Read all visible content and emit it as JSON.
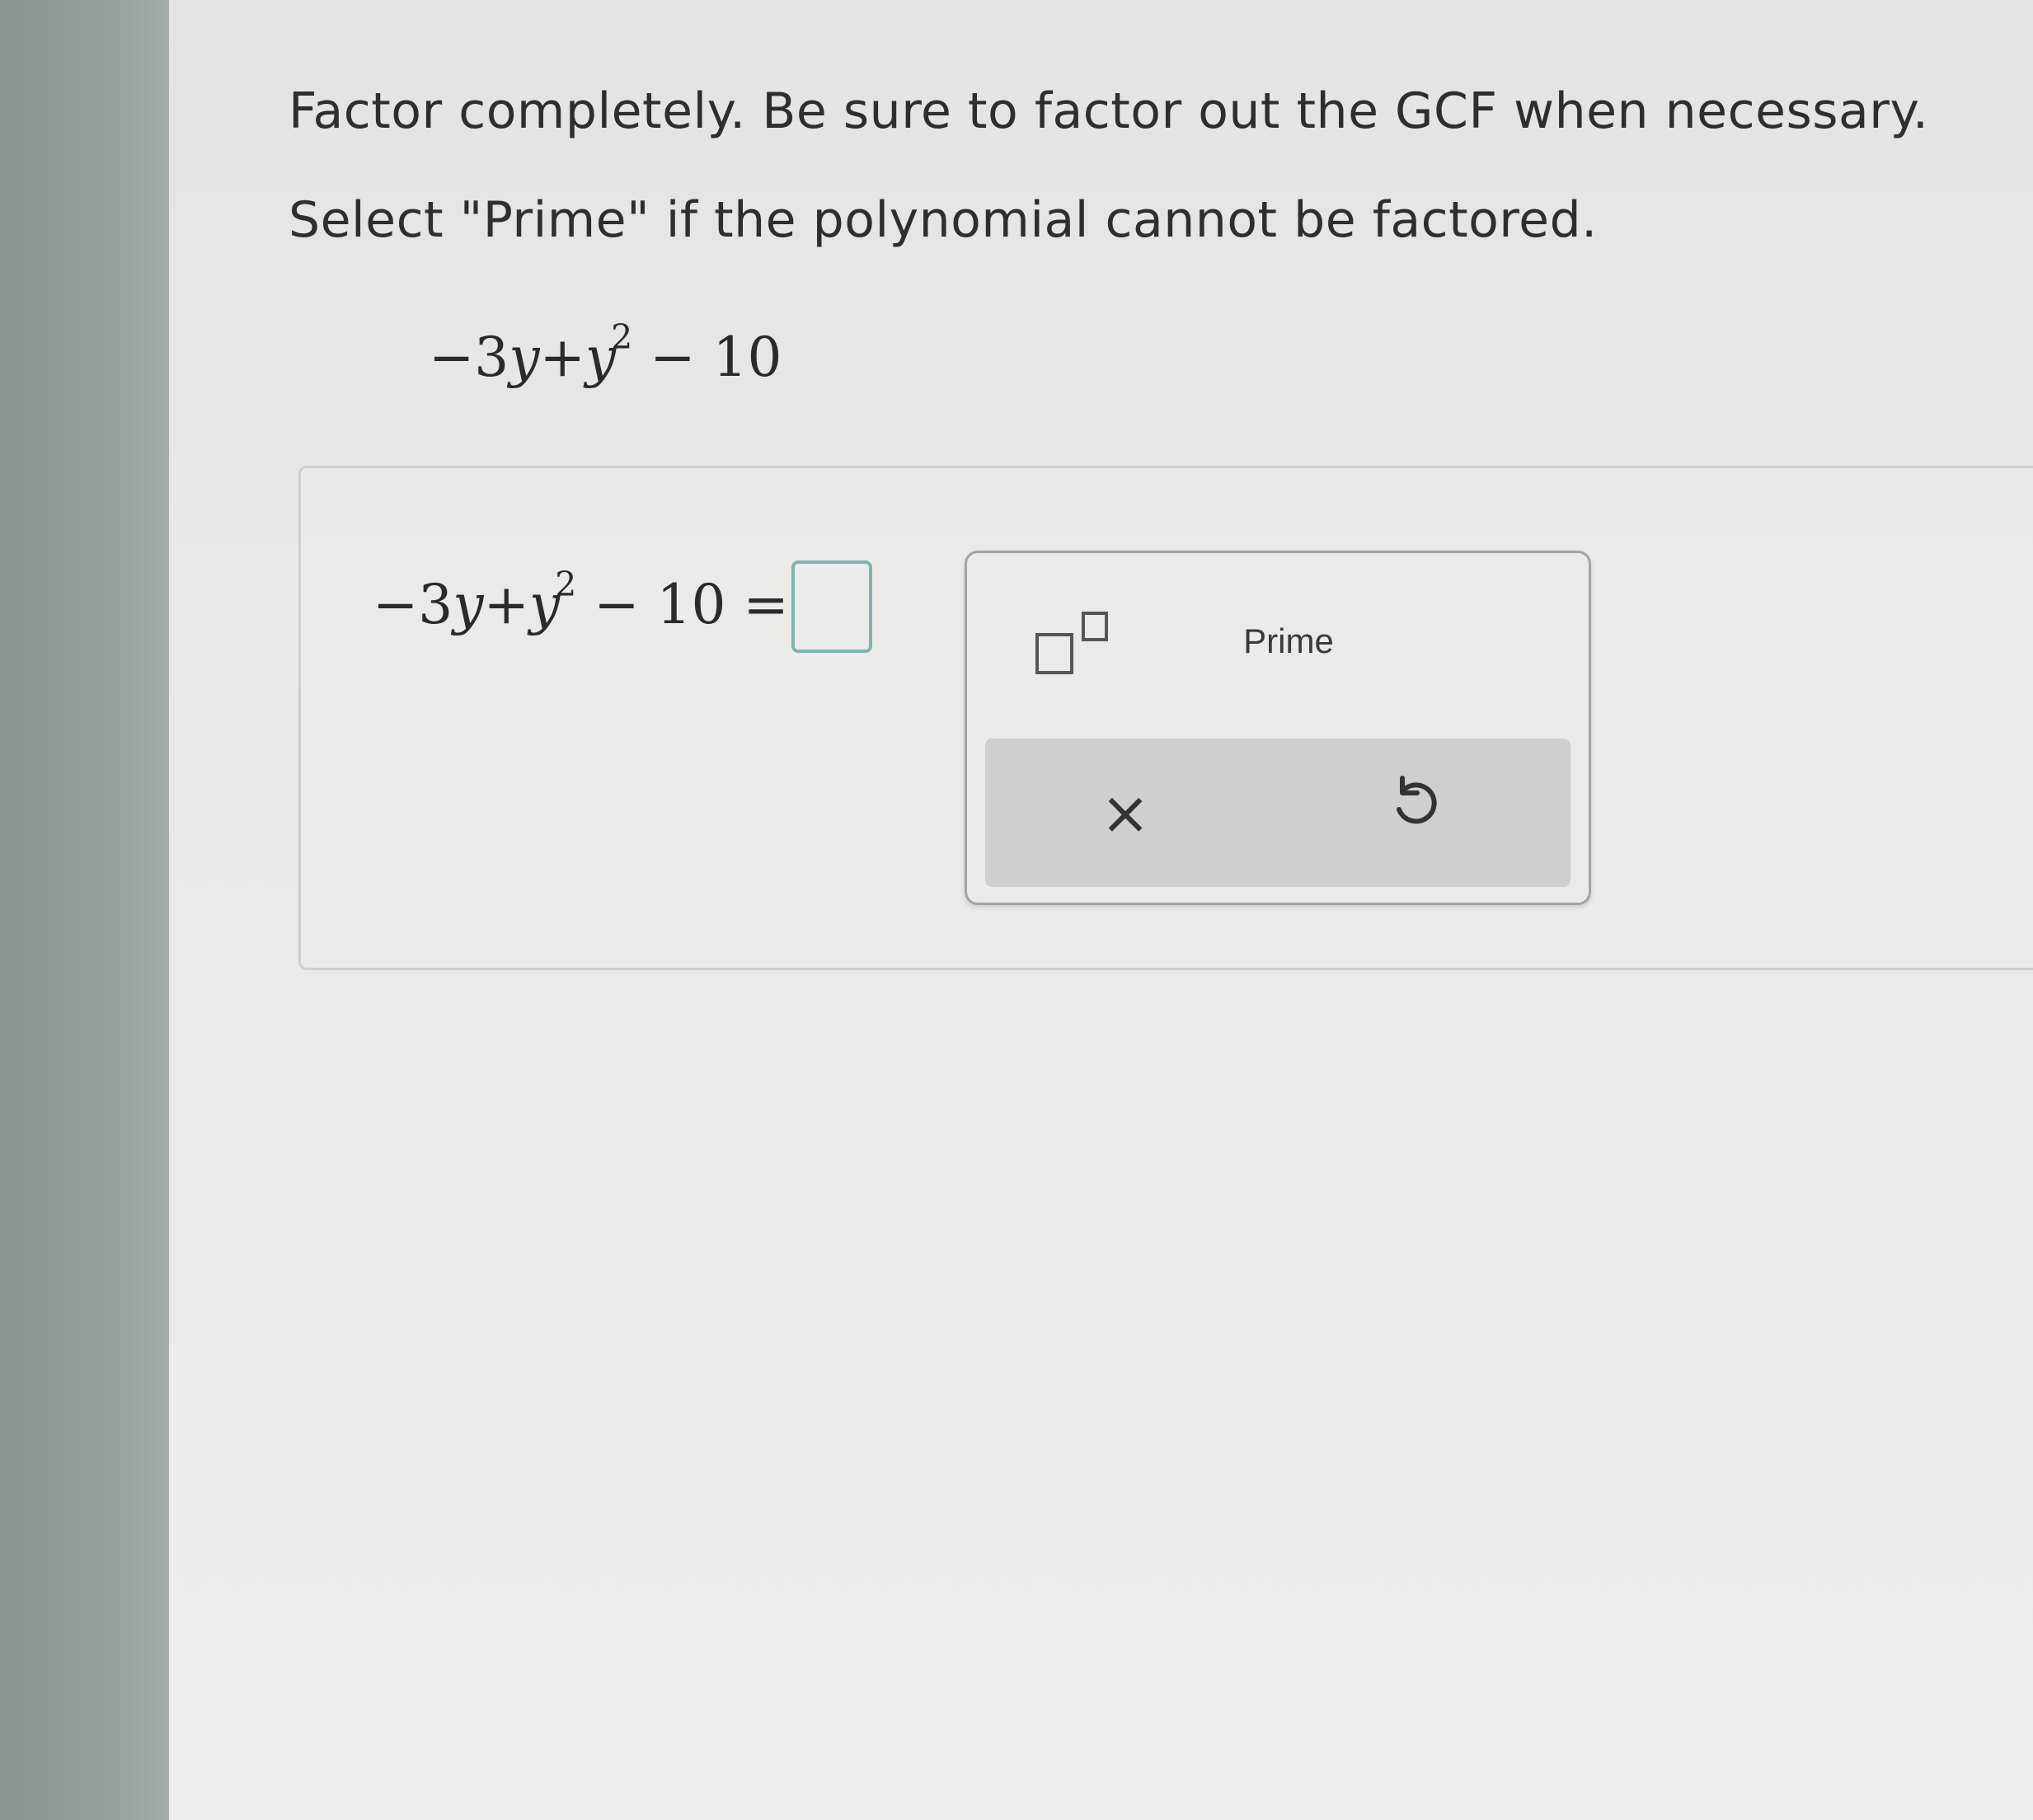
{
  "prompt": {
    "line1": "Factor completely. Be sure to factor out the GCF when necessary.",
    "line2": "Select \"Prime\" if the polynomial cannot be factored."
  },
  "expression": {
    "term1": "−3",
    "var1": "y",
    "plus": "+",
    "var2": "y",
    "exponent": "2",
    "tail": " − 10"
  },
  "answer": {
    "equals": " = ",
    "value": ""
  },
  "keypad": {
    "exponent_icon": "superscript-box-icon",
    "prime_label": "Prime",
    "clear_icon": "close-icon",
    "clear_symbol": "×",
    "undo_icon": "undo-icon"
  },
  "colors": {
    "input_border": "#7fb2ae",
    "keypad_footer": "#cdd0cd"
  }
}
